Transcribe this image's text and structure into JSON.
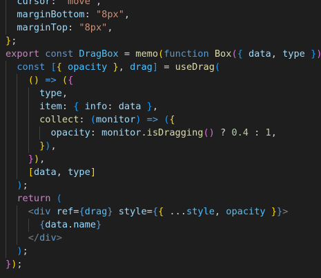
{
  "editor": {
    "theme_background": "#1e1e1e",
    "lines": [
      [
        {
          "t": "  ",
          "c": "punct"
        },
        {
          "t": "cursor",
          "c": "var"
        },
        {
          "t": ": ",
          "c": "punct"
        },
        {
          "t": "\"move\"",
          "c": "string"
        },
        {
          "t": ",",
          "c": "punct"
        }
      ],
      [
        {
          "t": "  ",
          "c": "punct"
        },
        {
          "t": "marginBottom",
          "c": "var"
        },
        {
          "t": ": ",
          "c": "punct"
        },
        {
          "t": "\"8px\"",
          "c": "string"
        },
        {
          "t": ",",
          "c": "punct"
        }
      ],
      [
        {
          "t": "  ",
          "c": "punct"
        },
        {
          "t": "marginTop",
          "c": "var"
        },
        {
          "t": ": ",
          "c": "punct"
        },
        {
          "t": "\"8px\"",
          "c": "string"
        },
        {
          "t": ",",
          "c": "punct"
        }
      ],
      [
        {
          "t": "}",
          "c": "b1"
        },
        {
          "t": ";",
          "c": "punct"
        }
      ],
      [
        {
          "t": "export",
          "c": "control"
        },
        {
          "t": " ",
          "c": "punct"
        },
        {
          "t": "const",
          "c": "keyword"
        },
        {
          "t": " ",
          "c": "punct"
        },
        {
          "t": "DragBox",
          "c": "const"
        },
        {
          "t": " = ",
          "c": "punct"
        },
        {
          "t": "memo",
          "c": "func"
        },
        {
          "t": "(",
          "c": "b1"
        },
        {
          "t": "function",
          "c": "keyword"
        },
        {
          "t": " ",
          "c": "punct"
        },
        {
          "t": "Box",
          "c": "func"
        },
        {
          "t": "(",
          "c": "b2"
        },
        {
          "t": "{",
          "c": "b3"
        },
        {
          "t": " ",
          "c": "punct"
        },
        {
          "t": "data",
          "c": "var"
        },
        {
          "t": ", ",
          "c": "punct"
        },
        {
          "t": "type",
          "c": "var"
        },
        {
          "t": " ",
          "c": "punct"
        },
        {
          "t": "}",
          "c": "b3"
        },
        {
          "t": ")",
          "c": "b2"
        },
        {
          "t": " ",
          "c": "punct"
        },
        {
          "t": "{",
          "c": "b2"
        }
      ],
      [
        {
          "t": "  ",
          "c": "punct"
        },
        {
          "t": "const",
          "c": "keyword"
        },
        {
          "t": " ",
          "c": "punct"
        },
        {
          "t": "[",
          "c": "b3"
        },
        {
          "t": "{",
          "c": "b1"
        },
        {
          "t": " ",
          "c": "punct"
        },
        {
          "t": "opacity",
          "c": "const"
        },
        {
          "t": " ",
          "c": "punct"
        },
        {
          "t": "}",
          "c": "b1"
        },
        {
          "t": ", ",
          "c": "punct"
        },
        {
          "t": "drag",
          "c": "const"
        },
        {
          "t": "]",
          "c": "b3"
        },
        {
          "t": " = ",
          "c": "punct"
        },
        {
          "t": "useDrag",
          "c": "func"
        },
        {
          "t": "(",
          "c": "b3"
        }
      ],
      [
        {
          "t": "    ",
          "c": "punct"
        },
        {
          "t": "()",
          "c": "b1"
        },
        {
          "t": " ",
          "c": "punct"
        },
        {
          "t": "=>",
          "c": "keyword"
        },
        {
          "t": " ",
          "c": "punct"
        },
        {
          "t": "(",
          "c": "b1"
        },
        {
          "t": "{",
          "c": "b2"
        }
      ],
      [
        {
          "t": "      ",
          "c": "punct"
        },
        {
          "t": "type",
          "c": "var"
        },
        {
          "t": ",",
          "c": "punct"
        }
      ],
      [
        {
          "t": "      ",
          "c": "punct"
        },
        {
          "t": "item",
          "c": "var"
        },
        {
          "t": ": ",
          "c": "punct"
        },
        {
          "t": "{",
          "c": "b3"
        },
        {
          "t": " ",
          "c": "punct"
        },
        {
          "t": "info",
          "c": "var"
        },
        {
          "t": ": ",
          "c": "punct"
        },
        {
          "t": "data",
          "c": "var"
        },
        {
          "t": " ",
          "c": "punct"
        },
        {
          "t": "}",
          "c": "b3"
        },
        {
          "t": ",",
          "c": "punct"
        }
      ],
      [
        {
          "t": "      ",
          "c": "punct"
        },
        {
          "t": "collect",
          "c": "func"
        },
        {
          "t": ": ",
          "c": "punct"
        },
        {
          "t": "(",
          "c": "b3"
        },
        {
          "t": "monitor",
          "c": "var"
        },
        {
          "t": ")",
          "c": "b3"
        },
        {
          "t": " ",
          "c": "punct"
        },
        {
          "t": "=>",
          "c": "keyword"
        },
        {
          "t": " ",
          "c": "punct"
        },
        {
          "t": "(",
          "c": "b3"
        },
        {
          "t": "{",
          "c": "b1"
        }
      ],
      [
        {
          "t": "        ",
          "c": "punct"
        },
        {
          "t": "opacity",
          "c": "var"
        },
        {
          "t": ": ",
          "c": "punct"
        },
        {
          "t": "monitor",
          "c": "var"
        },
        {
          "t": ".",
          "c": "punct"
        },
        {
          "t": "isDragging",
          "c": "func"
        },
        {
          "t": "()",
          "c": "b2"
        },
        {
          "t": " ? ",
          "c": "punct"
        },
        {
          "t": "0.4",
          "c": "number"
        },
        {
          "t": " : ",
          "c": "punct"
        },
        {
          "t": "1",
          "c": "number"
        },
        {
          "t": ",",
          "c": "punct"
        }
      ],
      [
        {
          "t": "      ",
          "c": "punct"
        },
        {
          "t": "}",
          "c": "b1"
        },
        {
          "t": ")",
          "c": "b3"
        },
        {
          "t": ",",
          "c": "punct"
        }
      ],
      [
        {
          "t": "    ",
          "c": "punct"
        },
        {
          "t": "}",
          "c": "b2"
        },
        {
          "t": ")",
          "c": "b1"
        },
        {
          "t": ",",
          "c": "punct"
        }
      ],
      [
        {
          "t": "    ",
          "c": "punct"
        },
        {
          "t": "[",
          "c": "b1"
        },
        {
          "t": "data",
          "c": "var"
        },
        {
          "t": ", ",
          "c": "punct"
        },
        {
          "t": "type",
          "c": "var"
        },
        {
          "t": "]",
          "c": "b1"
        }
      ],
      [
        {
          "t": "  ",
          "c": "punct"
        },
        {
          "t": ")",
          "c": "b3"
        },
        {
          "t": ";",
          "c": "punct"
        }
      ],
      [
        {
          "t": "  ",
          "c": "punct"
        },
        {
          "t": "return",
          "c": "control"
        },
        {
          "t": " ",
          "c": "punct"
        },
        {
          "t": "(",
          "c": "b3"
        }
      ],
      [
        {
          "t": "    ",
          "c": "punct"
        },
        {
          "t": "<",
          "c": "tagpunc"
        },
        {
          "t": "div",
          "c": "tag"
        },
        {
          "t": " ",
          "c": "punct"
        },
        {
          "t": "ref",
          "c": "attr"
        },
        {
          "t": "=",
          "c": "punct"
        },
        {
          "t": "{",
          "c": "keyword"
        },
        {
          "t": "drag",
          "c": "const"
        },
        {
          "t": "}",
          "c": "keyword"
        },
        {
          "t": " ",
          "c": "punct"
        },
        {
          "t": "style",
          "c": "attr"
        },
        {
          "t": "=",
          "c": "punct"
        },
        {
          "t": "{",
          "c": "keyword"
        },
        {
          "t": "{",
          "c": "b1"
        },
        {
          "t": " ...",
          "c": "punct"
        },
        {
          "t": "style",
          "c": "const"
        },
        {
          "t": ", ",
          "c": "punct"
        },
        {
          "t": "opacity",
          "c": "const"
        },
        {
          "t": " ",
          "c": "punct"
        },
        {
          "t": "}",
          "c": "b1"
        },
        {
          "t": "}",
          "c": "keyword"
        },
        {
          "t": ">",
          "c": "tagpunc"
        }
      ],
      [
        {
          "t": "      ",
          "c": "punct"
        },
        {
          "t": "{",
          "c": "keyword"
        },
        {
          "t": "data",
          "c": "var"
        },
        {
          "t": ".",
          "c": "punct"
        },
        {
          "t": "name",
          "c": "var"
        },
        {
          "t": "}",
          "c": "keyword"
        }
      ],
      [
        {
          "t": "    ",
          "c": "punct"
        },
        {
          "t": "</",
          "c": "tagpunc"
        },
        {
          "t": "div",
          "c": "tag"
        },
        {
          "t": ">",
          "c": "tagpunc"
        }
      ],
      [
        {
          "t": "  ",
          "c": "punct"
        },
        {
          "t": ")",
          "c": "b3"
        },
        {
          "t": ";",
          "c": "punct"
        }
      ],
      [
        {
          "t": "}",
          "c": "b2"
        },
        {
          "t": ")",
          "c": "b1"
        },
        {
          "t": ";",
          "c": "punct"
        }
      ]
    ]
  }
}
